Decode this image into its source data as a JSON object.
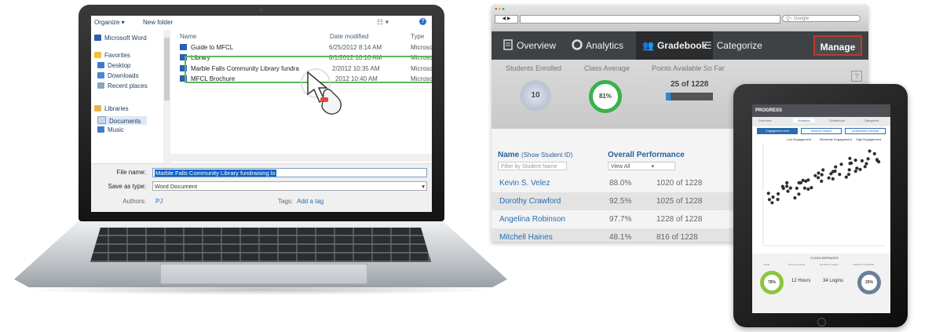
{
  "file_dialog": {
    "toolbar": {
      "organize": "Organize ▾",
      "new_folder": "New folder",
      "view": "☷ ▾",
      "help": "?"
    },
    "nav": [
      "Microsoft Word",
      "Favorites",
      "Desktop",
      "Downloads",
      "Recent places",
      "Libraries",
      "Documents",
      "Music"
    ],
    "columns": {
      "name": "Name",
      "date": "Date modified",
      "type": "Type"
    },
    "rows": [
      {
        "name": "Guide to MFCL",
        "date": "6/25/2012 8:14 AM",
        "type": "Microsoft"
      },
      {
        "name": "Library",
        "date": "8/1/2012 10:10 AM",
        "type": "Microsoft"
      },
      {
        "name": "Marble Falls Community Library fundra",
        "date": "2/2012 10:35 AM",
        "type": "Microsoft"
      },
      {
        "name": "MFCL Brochure",
        "date": "2012 10:40 AM",
        "type": "Microsoft"
      }
    ],
    "file_name_label": "File name:",
    "file_name_value": "Marble Falls Community Library fundraising lo",
    "save_type_label": "Save as type:",
    "save_type_value": "Word Document",
    "authors_label": "Authors:",
    "authors_value": "PJ",
    "tags_label": "Tags:",
    "tags_value": "Add a tag",
    "colors": {
      "highlight": "#5fb65a",
      "link": "#1e3a5f"
    }
  },
  "browser": {
    "search_placeholder": "Q~ Google",
    "tabs": [
      "Overview",
      "Analytics",
      "Gradebook",
      "Categorize"
    ],
    "active_tab": "Gradebook",
    "manage_label": "Manage",
    "stats": {
      "students_label": "Students Enrolled",
      "students_value": "10",
      "class_avg_label": "Class Average",
      "class_avg_value": "81%",
      "points_label": "Points Available So Far",
      "points_value": "25 of 1228",
      "points_progress": 0.02
    },
    "help": "?",
    "table": {
      "name_header": "Name",
      "name_sub": "(Show Student ID)",
      "perf_header": "Overall Performance",
      "filter_placeholder": "Filter by Student Name",
      "view_value": "View All",
      "rows": [
        {
          "name": "Kevin S. Velez",
          "pct": "88.0%",
          "pts": "1020 of 1228"
        },
        {
          "name": "Dorothy Crawford",
          "pct": "92.5%",
          "pts": "1025 of 1228"
        },
        {
          "name": "Angelina Robinson",
          "pct": "97.7%",
          "pts": "1228 of 1228"
        },
        {
          "name": "Mitchell Haines",
          "pct": "48.1%",
          "pts": "816 of 1228"
        }
      ]
    },
    "colors": {
      "accent": "#3ab14a",
      "manage_border": "#c0392b",
      "link": "#2a6cb0"
    }
  },
  "tablet": {
    "app_title": "PROGRESS",
    "tabs": [
      "Overview",
      "Analytics",
      "Gradebook",
      "Categorize"
    ],
    "subtabs": [
      "Engagement Level",
      "Absence Graphs",
      "Achievement Increase"
    ],
    "chart_headers": [
      "Low Engagement",
      "Moderate Engagement",
      "High Engagement"
    ],
    "bottom_title": "CLASS AVERAGES",
    "bottom_labels": [
      "Grade",
      "Time on Course",
      "Number of Logins",
      "Activities Completed"
    ],
    "ring1": "78%",
    "hours": "12 Hours",
    "logins": "34 Logins",
    "ring2": "25%"
  }
}
